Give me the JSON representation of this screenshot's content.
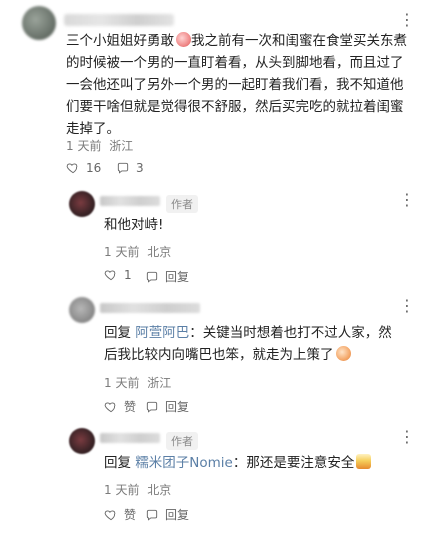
{
  "top_comment": {
    "text": "三个小姐姐好勇敢",
    "text_rest": "我之前有一次和闺蜜在食堂买关东煮的时候被一个男的一直盯着看，从头到脚地看，而且过了一会他还叫了另外一个男的一起盯着我们看，我不知道他们要干啥但就是觉得很不舒服，然后买完吃的就拉着闺蜜走掉了。",
    "time": "1 天前",
    "location": "浙江",
    "likes": "16",
    "comments": "3"
  },
  "replies": [
    {
      "author_tag": "作者",
      "text": "和他对峙!",
      "time": "1 天前",
      "location": "北京",
      "likes": "1",
      "reply_label": "回复"
    },
    {
      "prefix": "回复",
      "target": "阿萱阿巴",
      "text": "：关键当时想着也打不过人家，然后我比较内向嘴巴也笨，就走为上策了",
      "time": "1 天前",
      "location": "浙江",
      "like_label": "赞",
      "reply_label": "回复"
    },
    {
      "author_tag": "作者",
      "prefix": "回复",
      "target": "糯米团子Nomie",
      "text": "：那还是要注意安全",
      "time": "1 天前",
      "location": "北京",
      "like_label": "赞",
      "reply_label": "回复"
    }
  ],
  "icons": {
    "like": "heart-icon",
    "comment": "comment-icon",
    "more": "more-icon"
  }
}
